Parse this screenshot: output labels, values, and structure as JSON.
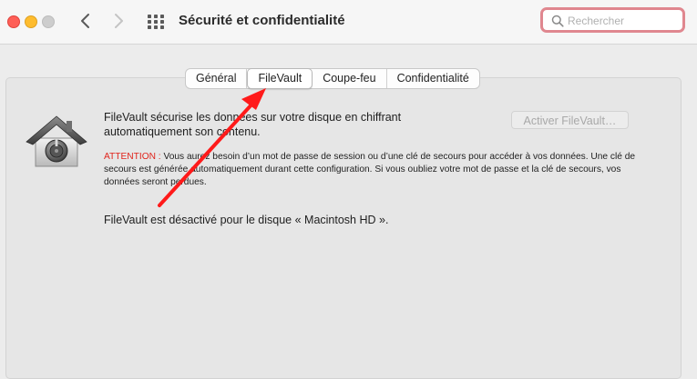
{
  "window": {
    "title": "Sécurité et confidentialité"
  },
  "search": {
    "placeholder": "Rechercher",
    "value": ""
  },
  "tabs": [
    {
      "label": "Général",
      "active": false
    },
    {
      "label": "FileVault",
      "active": true
    },
    {
      "label": "Coupe-feu",
      "active": false
    },
    {
      "label": "Confidentialité",
      "active": false
    }
  ],
  "filevault": {
    "description": "FileVault sécurise les données sur votre disque en chiffrant automatiquement son contenu.",
    "activate_button": "Activer FileVault…",
    "warning_label": "ATTENTION :",
    "warning_text": " Vous aurez besoin d’un mot de passe de session ou d’une clé de secours pour accéder à vos données. Une clé de secours est générée automatiquement durant cette configuration. Si vous oubliez votre mot de passe et la clé de secours, vos données seront perdues.",
    "status": "FileVault est désactivé pour le disque « Macintosh HD  »."
  },
  "colors": {
    "close": "#fe5f57",
    "minimize": "#febc2e",
    "zoom_disabled": "#cdcdcd",
    "warning_red": "#e0241c",
    "annotation_arrow": "#ff1a1a",
    "search_focus_ring": "#e0878f"
  },
  "icons": {
    "back": "chevron-left-icon",
    "forward": "chevron-right-icon",
    "show_all": "grid-icon",
    "search": "search-icon",
    "filevault": "house-safe-icon"
  }
}
